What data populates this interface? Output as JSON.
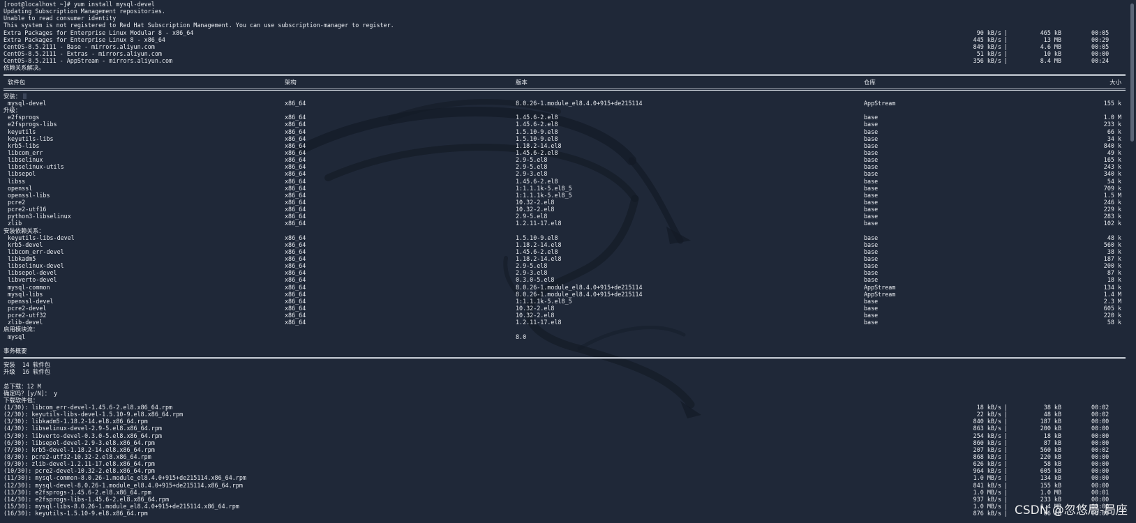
{
  "prompt": "[root@localhost ~]# yum install mysql-devel",
  "intro_lines": [
    "Updating Subscription Management repositories.",
    "Unable to read consumer identity",
    "This system is not registered to Red Hat Subscription Management. You can use subscription-manager to register."
  ],
  "repos": [
    {
      "name": "Extra Packages for Enterprise Linux Modular 8 - x86_64",
      "rate": "90 kB/s",
      "size": "465 kB",
      "time": "00:05"
    },
    {
      "name": "Extra Packages for Enterprise Linux 8 - x86_64",
      "rate": "445 kB/s",
      "size": "13 MB",
      "time": "00:29"
    },
    {
      "name": "CentOS-8.5.2111 - Base - mirrors.aliyun.com",
      "rate": "849 kB/s",
      "size": "4.6 MB",
      "time": "00:05"
    },
    {
      "name": "CentOS-8.5.2111 - Extras - mirrors.aliyun.com",
      "rate": "51 kB/s",
      "size": "10 kB",
      "time": "00:00"
    },
    {
      "name": "CentOS-8.5.2111 - AppStream - mirrors.aliyun.com",
      "rate": "356 kB/s",
      "size": "8.4 MB",
      "time": "00:24"
    }
  ],
  "deps_resolved": "依赖关系解决。",
  "table_headers": {
    "package": "软件包",
    "arch": "架构",
    "version": "版本",
    "repo": "仓库",
    "size": "大小"
  },
  "sections": [
    {
      "title": "安装：",
      "cursor": true,
      "rows": [
        [
          "mysql-devel",
          "x86_64",
          "8.0.26-1.module_el8.4.0+915+de215114",
          "AppStream",
          "155 k"
        ]
      ]
    },
    {
      "title": "升级：",
      "cursor": false,
      "rows": [
        [
          "e2fsprogs",
          "x86_64",
          "1.45.6-2.el8",
          "base",
          "1.0 M"
        ],
        [
          "e2fsprogs-libs",
          "x86_64",
          "1.45.6-2.el8",
          "base",
          "233 k"
        ],
        [
          "keyutils",
          "x86_64",
          "1.5.10-9.el8",
          "base",
          "66 k"
        ],
        [
          "keyutils-libs",
          "x86_64",
          "1.5.10-9.el8",
          "base",
          "34 k"
        ],
        [
          "krb5-libs",
          "x86_64",
          "1.18.2-14.el8",
          "base",
          "840 k"
        ],
        [
          "libcom_err",
          "x86_64",
          "1.45.6-2.el8",
          "base",
          "49 k"
        ],
        [
          "libselinux",
          "x86_64",
          "2.9-5.el8",
          "base",
          "165 k"
        ],
        [
          "libselinux-utils",
          "x86_64",
          "2.9-5.el8",
          "base",
          "243 k"
        ],
        [
          "libsepol",
          "x86_64",
          "2.9-3.el8",
          "base",
          "340 k"
        ],
        [
          "libss",
          "x86_64",
          "1.45.6-2.el8",
          "base",
          "54 k"
        ],
        [
          "openssl",
          "x86_64",
          "1:1.1.1k-5.el8_5",
          "base",
          "709 k"
        ],
        [
          "openssl-libs",
          "x86_64",
          "1:1.1.1k-5.el8_5",
          "base",
          "1.5 M"
        ],
        [
          "pcre2",
          "x86_64",
          "10.32-2.el8",
          "base",
          "246 k"
        ],
        [
          "pcre2-utf16",
          "x86_64",
          "10.32-2.el8",
          "base",
          "229 k"
        ],
        [
          "python3-libselinux",
          "x86_64",
          "2.9-5.el8",
          "base",
          "283 k"
        ],
        [
          "zlib",
          "x86_64",
          "1.2.11-17.el8",
          "base",
          "102 k"
        ]
      ]
    },
    {
      "title": "安装依赖关系：",
      "cursor": false,
      "rows": [
        [
          "keyutils-libs-devel",
          "x86_64",
          "1.5.10-9.el8",
          "base",
          "48 k"
        ],
        [
          "krb5-devel",
          "x86_64",
          "1.18.2-14.el8",
          "base",
          "560 k"
        ],
        [
          "libcom_err-devel",
          "x86_64",
          "1.45.6-2.el8",
          "base",
          "38 k"
        ],
        [
          "libkadm5",
          "x86_64",
          "1.18.2-14.el8",
          "base",
          "187 k"
        ],
        [
          "libselinux-devel",
          "x86_64",
          "2.9-5.el8",
          "base",
          "200 k"
        ],
        [
          "libsepol-devel",
          "x86_64",
          "2.9-3.el8",
          "base",
          "87 k"
        ],
        [
          "libverto-devel",
          "x86_64",
          "0.3.0-5.el8",
          "base",
          "18 k"
        ],
        [
          "mysql-common",
          "x86_64",
          "8.0.26-1.module_el8.4.0+915+de215114",
          "AppStream",
          "134 k"
        ],
        [
          "mysql-libs",
          "x86_64",
          "8.0.26-1.module_el8.4.0+915+de215114",
          "AppStream",
          "1.4 M"
        ],
        [
          "openssl-devel",
          "x86_64",
          "1:1.1.1k-5.el8_5",
          "base",
          "2.3 M"
        ],
        [
          "pcre2-devel",
          "x86_64",
          "10.32-2.el8",
          "base",
          "605 k"
        ],
        [
          "pcre2-utf32",
          "x86_64",
          "10.32-2.el8",
          "base",
          "220 k"
        ],
        [
          "zlib-devel",
          "x86_64",
          "1.2.11-17.el8",
          "base",
          "58 k"
        ]
      ]
    },
    {
      "title": "启用模块流：",
      "cursor": false,
      "rows": [
        [
          "mysql",
          "",
          "8.0",
          "",
          ""
        ]
      ]
    }
  ],
  "summary_title": "事务概要",
  "summary_lines": [
    "安装  14 软件包",
    "升级  16 软件包"
  ],
  "total_download": "总下载：12 M",
  "confirm": "确定吗？[y/N]： y",
  "download_header": "下载软件包：",
  "downloads": [
    {
      "name": "(1/30): libcom_err-devel-1.45.6-2.el8.x86_64.rpm",
      "rate": "18 kB/s",
      "size": "38 kB",
      "time": "00:02"
    },
    {
      "name": "(2/30): keyutils-libs-devel-1.5.10-9.el8.x86_64.rpm",
      "rate": "22 kB/s",
      "size": "48 kB",
      "time": "00:02"
    },
    {
      "name": "(3/30): libkadm5-1.18.2-14.el8.x86_64.rpm",
      "rate": "840 kB/s",
      "size": "187 kB",
      "time": "00:00"
    },
    {
      "name": "(4/30): libselinux-devel-2.9-5.el8.x86_64.rpm",
      "rate": "863 kB/s",
      "size": "200 kB",
      "time": "00:00"
    },
    {
      "name": "(5/30): libverto-devel-0.3.0-5.el8.x86_64.rpm",
      "rate": "254 kB/s",
      "size": "18 kB",
      "time": "00:00"
    },
    {
      "name": "(6/30): libsepol-devel-2.9-3.el8.x86_64.rpm",
      "rate": "860 kB/s",
      "size": "87 kB",
      "time": "00:00"
    },
    {
      "name": "(7/30): krb5-devel-1.18.2-14.el8.x86_64.rpm",
      "rate": "207 kB/s",
      "size": "560 kB",
      "time": "00:02"
    },
    {
      "name": "(8/30): pcre2-utf32-10.32-2.el8.x86_64.rpm",
      "rate": "868 kB/s",
      "size": "220 kB",
      "time": "00:00"
    },
    {
      "name": "(9/30): zlib-devel-1.2.11-17.el8.x86_64.rpm",
      "rate": "626 kB/s",
      "size": "58 kB",
      "time": "00:00"
    },
    {
      "name": "(10/30): pcre2-devel-10.32-2.el8.x86_64.rpm",
      "rate": "964 kB/s",
      "size": "605 kB",
      "time": "00:00"
    },
    {
      "name": "(11/30): mysql-common-8.0.26-1.module_el8.4.0+915+de215114.x86_64.rpm",
      "rate": "1.0 MB/s",
      "size": "134 kB",
      "time": "00:00"
    },
    {
      "name": "(12/30): mysql-devel-8.0.26-1.module_el8.4.0+915+de215114.x86_64.rpm",
      "rate": "841 kB/s",
      "size": "155 kB",
      "time": "00:00"
    },
    {
      "name": "(13/30): e2fsprogs-1.45.6-2.el8.x86_64.rpm",
      "rate": "1.0 MB/s",
      "size": "1.0 MB",
      "time": "00:01"
    },
    {
      "name": "(14/30): e2fsprogs-libs-1.45.6-2.el8.x86_64.rpm",
      "rate": "937 kB/s",
      "size": "233 kB",
      "time": "00:00"
    },
    {
      "name": "(15/30): mysql-libs-8.0.26-1.module_el8.4.0+915+de215114.x86_64.rpm",
      "rate": "1.0 MB/s",
      "size": "1.4 MB",
      "time": "00:00"
    },
    {
      "name": "(16/30): keyutils-1.5.10-9.el8.x86_64.rpm",
      "rate": "876 kB/s",
      "size": "66 kB",
      "time": "00:00"
    }
  ],
  "watermark": "CSDN @忽悠局-局座",
  "colors": {
    "background": "#1f2838",
    "text": "#e8ebf0",
    "rule": "#cfd5dd",
    "logo": "#141b27"
  },
  "icons": {
    "background": "kali-dragon-icon"
  }
}
